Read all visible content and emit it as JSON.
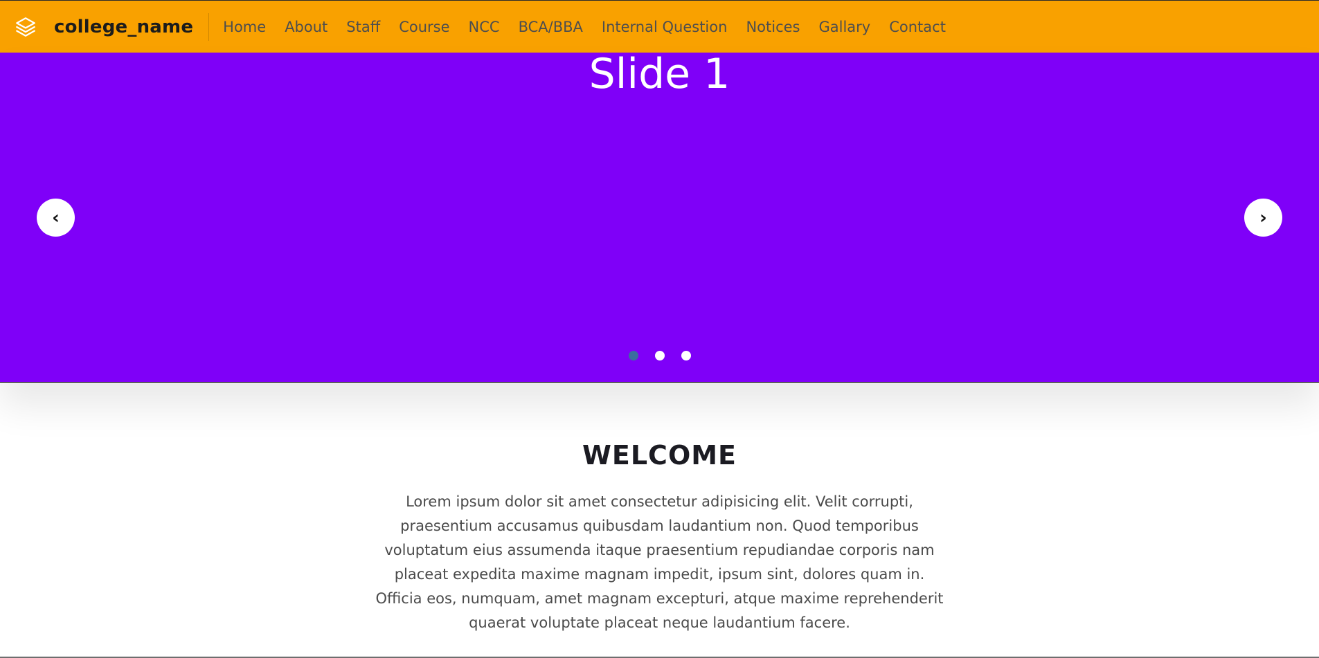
{
  "colors": {
    "navbar_bg": "#f9a100",
    "slide_bg": "#7f00f8",
    "active_indicator": "#3a6e9e",
    "indicator": "#ffffff"
  },
  "navbar": {
    "brand_icon": "layers-icon",
    "brand_name": "college_name",
    "links": [
      "Home",
      "About",
      "Staff",
      "Course",
      "NCC",
      "BCA/BBA",
      "Internal Question",
      "Notices",
      "Gallary",
      "Contact"
    ]
  },
  "carousel": {
    "slide_title": "Slide 1",
    "prev_icon": "chevron-left-icon",
    "prev_glyph": "‹",
    "next_icon": "chevron-right-icon",
    "next_glyph": "›",
    "slide_count": 3,
    "active_index": 0
  },
  "welcome": {
    "title": "WELCOME",
    "text": "Lorem ipsum dolor sit amet consectetur adipisicing elit. Velit corrupti, praesentium accusamus quibusdam laudantium non. Quod temporibus voluptatum eius assumenda itaque praesentium repudiandae corporis nam placeat expedita maxime magnam impedit, ipsum sint, dolores quam in. Officia eos, numquam, amet magnam excepturi, atque maxime reprehenderit quaerat voluptate placeat neque laudantium facere."
  }
}
